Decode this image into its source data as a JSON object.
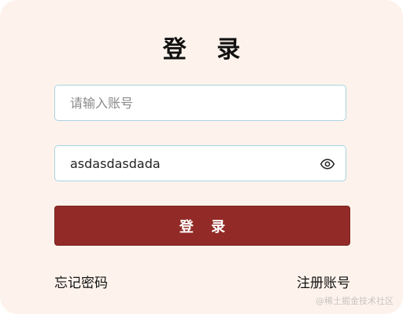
{
  "form": {
    "title": "登 录",
    "username_placeholder": "请输入账号",
    "username_value": "",
    "password_value": "asdasdasdada",
    "password_toggle_icon": "eye-icon",
    "submit_label": "登 录"
  },
  "links": {
    "forgot_password": "忘记密码",
    "register": "注册账号"
  },
  "watermark": "@稀土掘金技术社区",
  "colors": {
    "background": "#fdf3ec",
    "button": "#922b27",
    "input_border": "#a9d3e3"
  }
}
